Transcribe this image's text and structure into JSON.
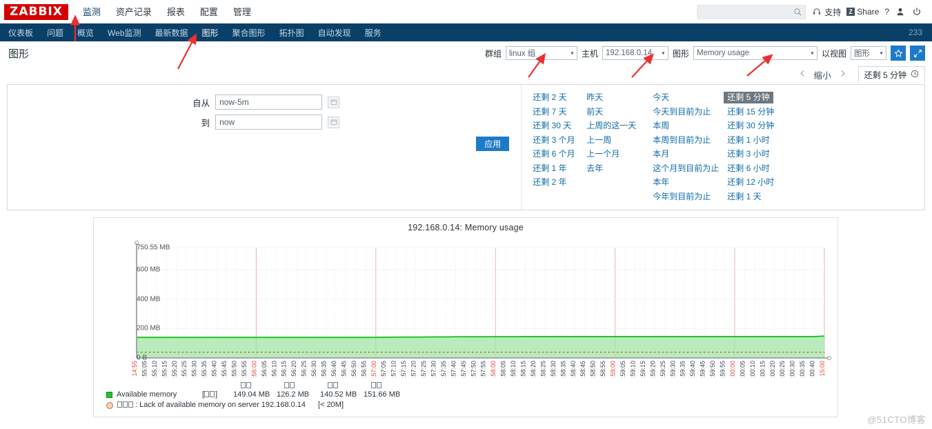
{
  "brand": {
    "logo": "ZABBIX"
  },
  "main_menu": {
    "items": [
      {
        "label": "监测",
        "active": true
      },
      {
        "label": "资产记录",
        "active": false
      },
      {
        "label": "报表",
        "active": false
      },
      {
        "label": "配置",
        "active": false
      },
      {
        "label": "管理",
        "active": false
      }
    ]
  },
  "topright": {
    "search_placeholder": "",
    "search_value": "",
    "support_label": "支持",
    "share_label": "Share",
    "share_badge": "Z",
    "help_label": "?",
    "user_icon": "user-icon",
    "signout_icon": "power-icon",
    "search_icon": "search-icon",
    "support_icon": "headset-icon"
  },
  "subnav": {
    "items": [
      {
        "label": "仪表板",
        "active": false
      },
      {
        "label": "问题",
        "active": false
      },
      {
        "label": "概览",
        "active": false
      },
      {
        "label": "Web监测",
        "active": false
      },
      {
        "label": "最新数据",
        "active": false
      },
      {
        "label": "图形",
        "active": true
      },
      {
        "label": "聚合图形",
        "active": false
      },
      {
        "label": "拓扑图",
        "active": false
      },
      {
        "label": "自动发现",
        "active": false
      },
      {
        "label": "服务",
        "active": false
      }
    ],
    "counter": "233"
  },
  "page": {
    "title": "图形"
  },
  "filters": {
    "group_label": "群组",
    "group_value": "linux 组",
    "host_label": "主机",
    "host_value": "192.168.0.14",
    "graph_label": "图形",
    "graph_value": "Memory usage",
    "view_label": "以视图",
    "view_value": "图形",
    "favorite_icon": "star-icon",
    "fullscreen_icon": "expand-icon"
  },
  "zoomrow": {
    "prev_icon": "chevron-left-icon",
    "zoom_out_label": "缩小",
    "next_icon": "chevron-right-icon",
    "time_tab_label": "还剩 5 分钟",
    "clock_icon": "clock-icon"
  },
  "timepanel": {
    "from_label": "自从",
    "from_value": "now-5m",
    "to_label": "到",
    "to_value": "now",
    "calendar_icon": "calendar-icon",
    "apply_label": "应用",
    "quick_columns": [
      {
        "links": [
          "还剩 2 天",
          "还剩 7 天",
          "还剩 30 天",
          "还剩 3 个月",
          "还剩 6 个月",
          "还剩 1 年",
          "还剩 2 年"
        ]
      },
      {
        "links": [
          "昨天",
          "前天",
          "上周的这一天",
          "上一周",
          "上一个月",
          "去年"
        ]
      },
      {
        "links": [
          "今天",
          "今天到目前为止",
          "本周",
          "本周到目前为止",
          "本月",
          "这个月到目前为止",
          "本年",
          "今年到目前为止"
        ]
      },
      {
        "links": [
          "还剩 5 分钟",
          "还剩 15 分钟",
          "还剩 30 分钟",
          "还剩 1 小时",
          "还剩 3 小时",
          "还剩 6 小时",
          "还剩 12 小时",
          "还剩 1 天"
        ]
      }
    ],
    "selected_quick": "还剩 5 分钟"
  },
  "graph": {
    "title": "192.168.0.14: Memory usage",
    "legend": {
      "series_name": "Available memory",
      "series_tag": "[□□]",
      "stat_headers": [
        "□□",
        "□□",
        "□□",
        "□□"
      ],
      "stat_values": [
        "149.04 MB",
        "126.2 MB",
        "140.52 MB",
        "151.66 MB"
      ],
      "trigger_label": "□□□",
      "trigger_text": ": Lack of available memory on server 192.168.0.14",
      "trigger_threshold": "[< 20M]"
    }
  },
  "watermark": "@51CTO博客",
  "colors": {
    "brand_red": "#d40000",
    "nav_blue": "#0a4067",
    "accent_blue": "#1d7ac9",
    "series_green": "#22c32f",
    "series_fill": "#9fe3a3",
    "trigger_orange": "#d9a441",
    "axis_red": "#e04a3f"
  },
  "chart_data": {
    "type": "area",
    "title": "192.168.0.14: Memory usage",
    "xlabel": "",
    "ylabel": "",
    "ylim": [
      0,
      750.55
    ],
    "ytick_labels": [
      "750.55 MB",
      "600 MB",
      "400 MB",
      "200 MB",
      "0 B"
    ],
    "ytick_values": [
      750.55,
      600,
      400,
      200,
      0
    ],
    "grid": true,
    "legend_position": "bottom-left",
    "x_start_label": "09-17 14:55",
    "x_end_label": "09-17 15:00",
    "x_tick_labels": [
      "09-17 14:55",
      "14:55:05",
      "14:55:10",
      "14:55:15",
      "14:55:20",
      "14:55:25",
      "14:55:30",
      "14:55:35",
      "14:55:40",
      "14:55:45",
      "14:55:50",
      "14:55:55",
      "14:56:00",
      "14:56:05",
      "14:56:10",
      "14:56:15",
      "14:56:20",
      "14:56:25",
      "14:56:30",
      "14:56:35",
      "14:56:40",
      "14:56:45",
      "14:56:50",
      "14:56:55",
      "14:57:00",
      "14:57:05",
      "14:57:10",
      "14:57:15",
      "14:57:20",
      "14:57:25",
      "14:57:30",
      "14:57:35",
      "14:57:40",
      "14:57:45",
      "14:57:50",
      "14:57:55",
      "14:58:00",
      "14:58:05",
      "14:58:10",
      "14:58:15",
      "14:58:20",
      "14:58:25",
      "14:58:30",
      "14:58:35",
      "14:58:40",
      "14:58:45",
      "14:58:50",
      "14:58:55",
      "14:59:00",
      "14:59:05",
      "14:59:10",
      "14:59:15",
      "14:59:20",
      "14:59:25",
      "14:59:30",
      "14:59:35",
      "14:59:40",
      "14:59:45",
      "14:59:50",
      "14:59:55",
      "15:00:00",
      "15:00:05",
      "15:00:10",
      "15:00:15",
      "15:00:20",
      "15:00:25",
      "15:00:30",
      "15:00:35",
      "15:00:40",
      "09-17 15:00"
    ],
    "x_major_labels": [
      "09-17 14:55",
      "14:56:00",
      "14:57:00",
      "14:58:00",
      "14:59:00",
      "15:00:00",
      "09-17 15:00"
    ],
    "series": [
      {
        "name": "Available memory",
        "color": "#22c32f",
        "fill": "#9fe3a3",
        "unit": "MB",
        "last": 149.04,
        "min": 126.2,
        "avg": 140.52,
        "max": 151.66,
        "values": [
          140.2,
          140.2,
          140.1,
          140.2,
          140.2,
          140.1,
          140.2,
          140.2,
          140.1,
          140.2,
          140.2,
          140.1,
          140.2,
          140.2,
          140.1,
          140.2,
          140.2,
          140.1,
          140.2,
          140.2,
          140.1,
          140.2,
          140.2,
          140.1,
          140.2,
          140.5,
          141.0,
          141.6,
          142.2,
          142.5,
          142.9,
          143.3,
          143.8,
          144.2,
          144.4,
          144.6,
          144.8,
          145.0,
          145.1,
          145.2,
          145.3,
          145.3,
          145.3,
          145.3,
          145.3,
          145.3,
          145.2,
          145.2,
          145.2,
          145.2,
          145.2,
          145.2,
          145.2,
          145.2,
          145.2,
          145.2,
          145.2,
          145.2,
          145.2,
          145.2,
          145.2,
          145.2,
          145.2,
          145.2,
          145.2,
          145.2,
          145.2,
          145.2,
          145.2,
          149.04
        ]
      }
    ],
    "trigger": {
      "label": "Lack of available memory on server 192.168.0.14",
      "threshold": 20,
      "threshold_label": "[< 20M]",
      "style": "dashed",
      "color": "#d9a441"
    }
  }
}
